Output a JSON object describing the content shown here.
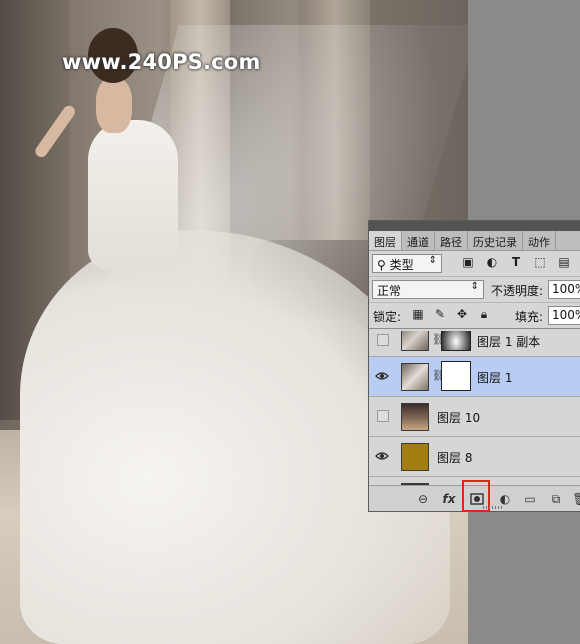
{
  "photo": {
    "watermark": "www.240PS.com"
  },
  "panel": {
    "tabs": [
      {
        "label": "图层",
        "active": true
      },
      {
        "label": "通道",
        "active": false
      },
      {
        "label": "路径",
        "active": false
      },
      {
        "label": "历史记录",
        "active": false
      },
      {
        "label": "动作",
        "active": false
      }
    ],
    "filter": {
      "kind_label": "类型",
      "icons": [
        "image-filter-icon",
        "adjustment-filter-icon",
        "type-filter-icon",
        "shape-filter-icon",
        "smart-object-filter-icon"
      ]
    },
    "blend": {
      "mode": "正常",
      "opacity_label": "不透明度:",
      "opacity_value": "100%"
    },
    "lock": {
      "label": "锁定:",
      "fill_label": "填充:",
      "fill_value": "100%"
    },
    "layers": [
      {
        "name": "图层 1 副本",
        "visible": false,
        "selected": false,
        "has_mask": true
      },
      {
        "name": "图层 1",
        "visible": true,
        "selected": true,
        "has_mask": true
      },
      {
        "name": "图层 10",
        "visible": false,
        "selected": false,
        "has_mask": false
      },
      {
        "name": "图层 8",
        "visible": true,
        "selected": false,
        "has_mask": false
      }
    ],
    "bottom_icons": [
      "link-icon",
      "fx-icon",
      "add-mask-icon",
      "adjustment-layer-icon",
      "group-folder-icon",
      "new-layer-icon",
      "delete-icon"
    ],
    "fx_label": "fx"
  },
  "colors": {
    "selected_row": "#b9cdf4",
    "highlight_box": "#e2231a",
    "layer8_fill": "#a07e12"
  }
}
